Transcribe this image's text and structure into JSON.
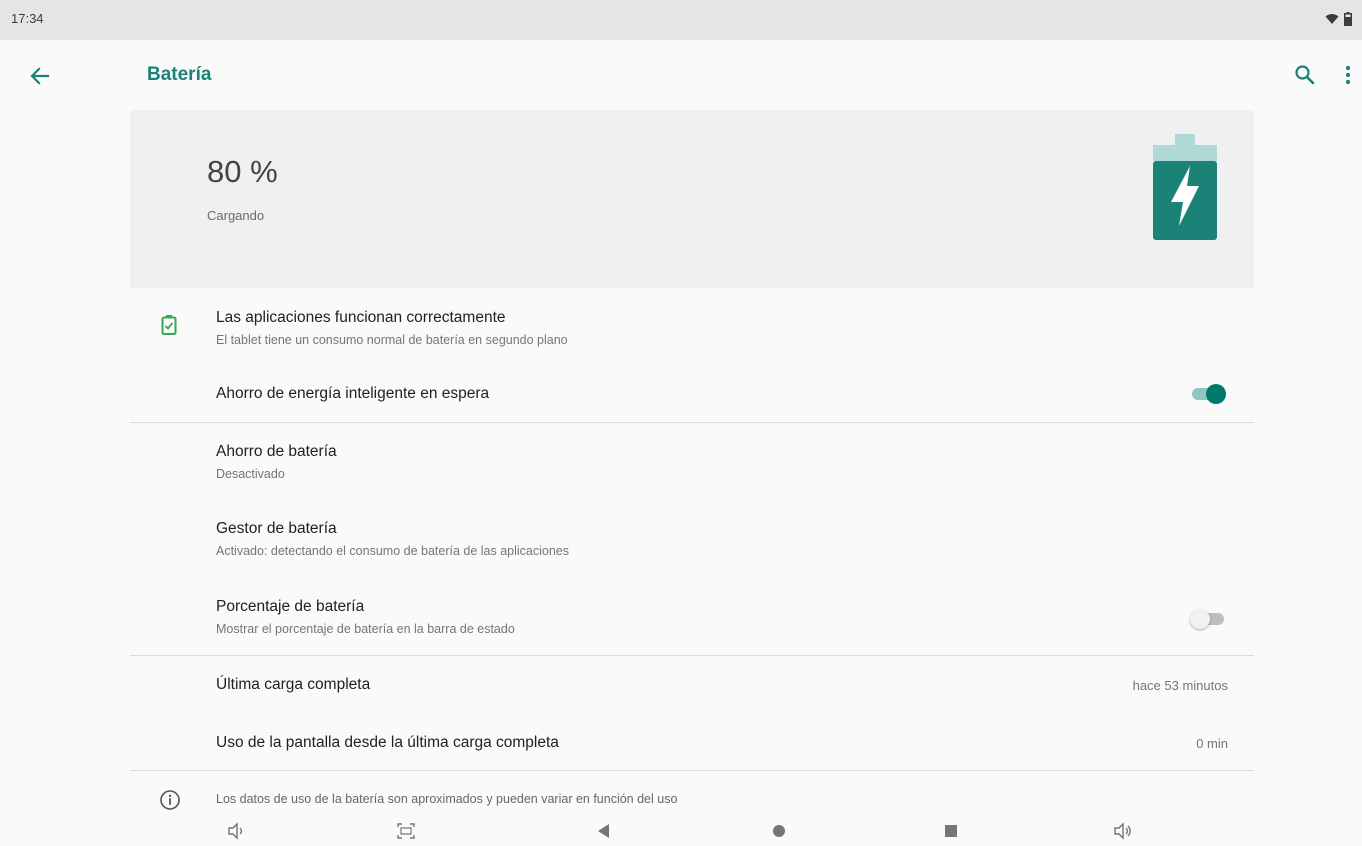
{
  "status_bar": {
    "time": "17:34",
    "icons": [
      "wifi-icon",
      "battery-icon"
    ]
  },
  "app_bar": {
    "title": "Batería",
    "icons": [
      "back-arrow-icon",
      "search-icon",
      "more-vert-icon"
    ]
  },
  "battery_header": {
    "percent": "80 %",
    "status": "Cargando",
    "icon": "battery-charging-icon"
  },
  "colors": {
    "accent": "#1a8277",
    "toggle_on": "#00796b",
    "ok_icon": "#34a853"
  },
  "items": [
    {
      "title": "Las aplicaciones funcionan correctamente",
      "subtitle": "El tablet tiene un consumo normal de batería en segundo plano",
      "icon": "battery-ok-icon"
    },
    {
      "title": "Ahorro de energía inteligente en espera",
      "toggle": true
    },
    {
      "title": "Ahorro de batería",
      "subtitle": "Desactivado"
    },
    {
      "title": "Gestor de batería",
      "subtitle": "Activado: detectando el consumo de batería de las aplicaciones"
    },
    {
      "title": "Porcentaje de batería",
      "subtitle": "Mostrar el porcentaje de batería en la barra de estado",
      "toggle": false
    },
    {
      "title": "Última carga completa",
      "value": "hace 53 minutos"
    },
    {
      "title": "Uso de la pantalla desde la última carga completa",
      "value": "0 min"
    }
  ],
  "footer": {
    "note": "Los datos de uso de la batería son aproximados y pueden variar en función del uso",
    "icon": "info-icon"
  },
  "nav_bar": {
    "icons": [
      "volume-down-icon",
      "screenshot-icon",
      "back-icon",
      "home-icon",
      "recents-icon",
      "volume-up-icon"
    ]
  }
}
